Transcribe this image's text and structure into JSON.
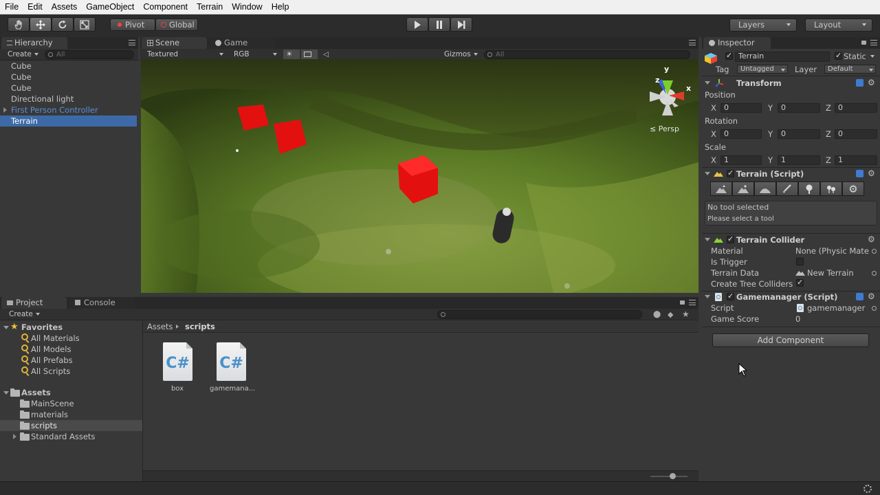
{
  "menu": [
    "File",
    "Edit",
    "Assets",
    "GameObject",
    "Component",
    "Terrain",
    "Window",
    "Help"
  ],
  "toolbar": {
    "pivot": "Pivot",
    "global": "Global",
    "layers": "Layers",
    "layout": "Layout"
  },
  "hierarchy": {
    "tab": "Hierarchy",
    "create": "Create",
    "search": "All",
    "items": [
      "Cube",
      "Cube",
      "Cube",
      "Directional light",
      "First Person Controller",
      "Terrain"
    ]
  },
  "scene": {
    "tab_scene": "Scene",
    "tab_game": "Game",
    "render_mode": "Textured",
    "color_mode": "RGB",
    "gizmos": "Gizmos",
    "search": "All",
    "persp": "Persp",
    "axis_x": "x",
    "axis_y": "y",
    "axis_z": "z"
  },
  "project": {
    "tab_project": "Project",
    "tab_console": "Console",
    "create": "Create",
    "favorites_label": "Favorites",
    "favorites": [
      "All Materials",
      "All Models",
      "All Prefabs",
      "All Scripts"
    ],
    "assets_label": "Assets",
    "folders": [
      "MainScene",
      "materials",
      "scripts",
      "Standard Assets"
    ],
    "breadcrumb_root": "Assets",
    "breadcrumb_current": "scripts",
    "files": [
      "box",
      "gamemana..."
    ],
    "cs_glyph": "C#"
  },
  "inspector": {
    "tab": "Inspector",
    "object_name": "Terrain",
    "static_label": "Static",
    "tag_label": "Tag",
    "tag_value": "Untagged",
    "layer_label": "Layer",
    "layer_value": "Default",
    "transform": {
      "title": "Transform",
      "position_label": "Position",
      "rotation_label": "Rotation",
      "scale_label": "Scale",
      "x": "X",
      "y": "Y",
      "z": "Z",
      "position": [
        "0",
        "0",
        "0"
      ],
      "rotation": [
        "0",
        "0",
        "0"
      ],
      "scale": [
        "1",
        "1",
        "1"
      ]
    },
    "terrain_script": {
      "title": "Terrain (Script)",
      "no_tool": "No tool selected",
      "hint": "Please select a tool"
    },
    "terrain_collider": {
      "title": "Terrain Collider",
      "material_label": "Material",
      "material_value": "None (Physic Mater",
      "trigger_label": "Is Trigger",
      "terrain_data_label": "Terrain Data",
      "terrain_data_value": "New Terrain",
      "tree_colliders_label": "Create Tree Colliders"
    },
    "gamemanager": {
      "title": "Gamemanager (Script)",
      "script_label": "Script",
      "script_value": "gamemanager",
      "score_label": "Game Score",
      "score_value": "0"
    },
    "add_component": "Add Component"
  },
  "colors": {
    "selection": "#3d6aa6",
    "prefab_blue": "#5b8fd8",
    "cube_red": "#e31010"
  }
}
